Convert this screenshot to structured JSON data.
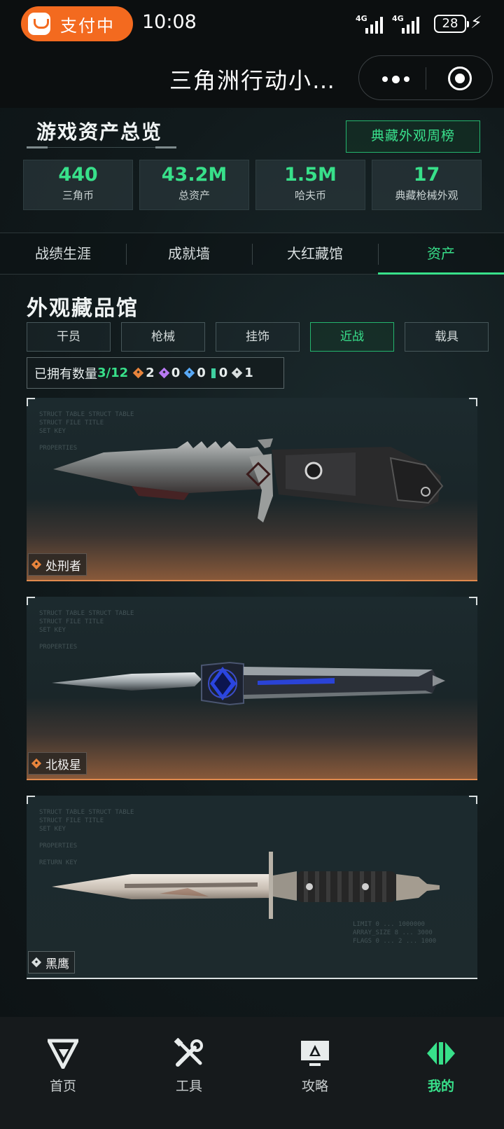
{
  "status_bar": {
    "pay_label": "支付中",
    "time": "10:08",
    "signal1": "4G",
    "signal2": "4G",
    "battery": "28"
  },
  "title_bar": {
    "title": "三角洲行动小…"
  },
  "overview": {
    "title": "游戏资产总览",
    "rank_button": "典藏外观周榜",
    "stats": [
      {
        "value": "440",
        "label": "三角币"
      },
      {
        "value": "43.2M",
        "label": "总资产"
      },
      {
        "value": "1.5M",
        "label": "哈夫币"
      },
      {
        "value": "17",
        "label": "典藏枪械外观"
      }
    ]
  },
  "tabs": [
    {
      "label": "战绩生涯"
    },
    {
      "label": "成就墙"
    },
    {
      "label": "大红藏馆"
    },
    {
      "label": "资产"
    }
  ],
  "gallery": {
    "title": "外观藏品馆",
    "filters": [
      {
        "label": "干员"
      },
      {
        "label": "枪械"
      },
      {
        "label": "挂饰"
      },
      {
        "label": "近战"
      },
      {
        "label": "载具"
      }
    ],
    "owned_label": "已拥有数量",
    "owned_count": "3/12",
    "rarity_counts": [
      "2",
      "0",
      "0",
      "0",
      "1"
    ],
    "items": [
      {
        "name": "处刑者",
        "rarity_color": "#e8843c"
      },
      {
        "name": "北极星",
        "rarity_color": "#e8843c"
      },
      {
        "name": "黑鹰",
        "rarity_color": "#d8dede"
      }
    ]
  },
  "bottom_nav": [
    {
      "label": "首页",
      "icon": "home-logo-icon"
    },
    {
      "label": "工具",
      "icon": "tools-icon"
    },
    {
      "label": "攻略",
      "icon": "guide-monitor-icon"
    },
    {
      "label": "我的",
      "icon": "profile-logo-icon"
    }
  ],
  "colors": {
    "accent": "#38e08a",
    "gold_rarity": "#e8843c"
  }
}
